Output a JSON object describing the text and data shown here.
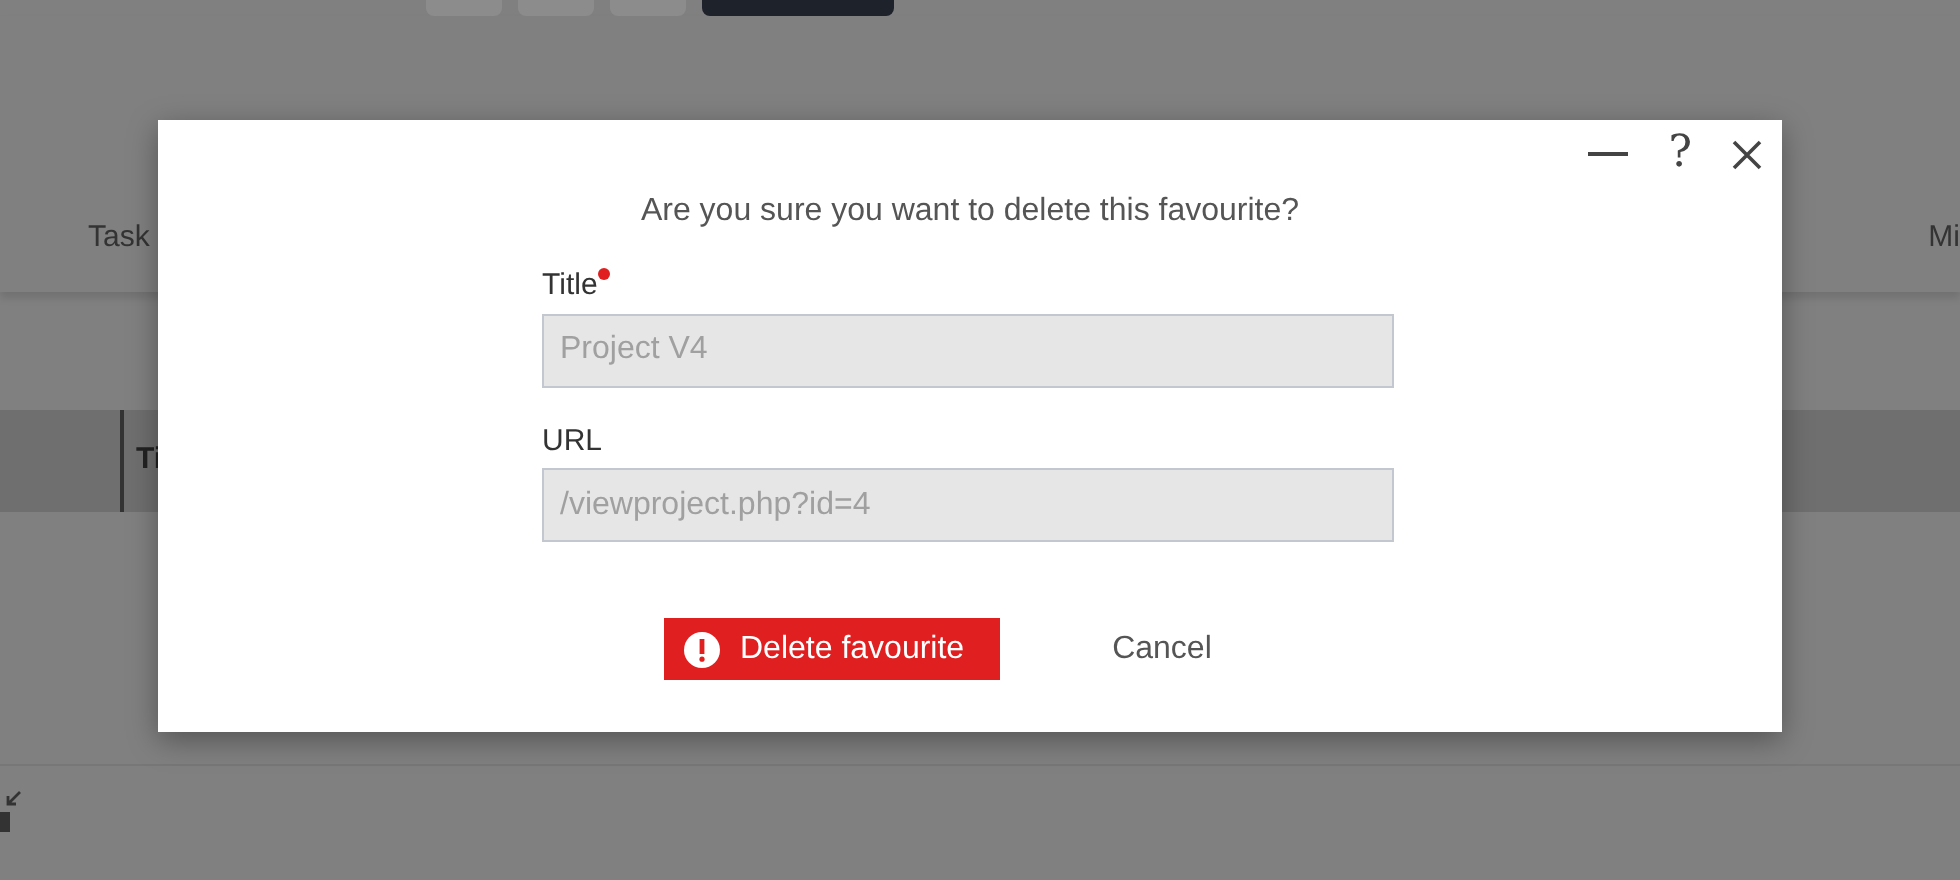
{
  "background": {
    "nav_items": [
      "Task",
      "Mi"
    ],
    "table": {
      "header": "Ti"
    }
  },
  "dialog": {
    "help": "?",
    "message": "Are you sure you want to delete this favourite?",
    "fields": [
      {
        "label": "Title",
        "required": true,
        "value": "Project V4",
        "disabled": true
      },
      {
        "label": "URL",
        "required": false,
        "value": "/viewproject.php?id=4",
        "disabled": true
      }
    ],
    "buttons": [
      {
        "kind": "danger",
        "label": "Delete favourite"
      },
      {
        "kind": "link",
        "label": "Cancel"
      }
    ]
  }
}
